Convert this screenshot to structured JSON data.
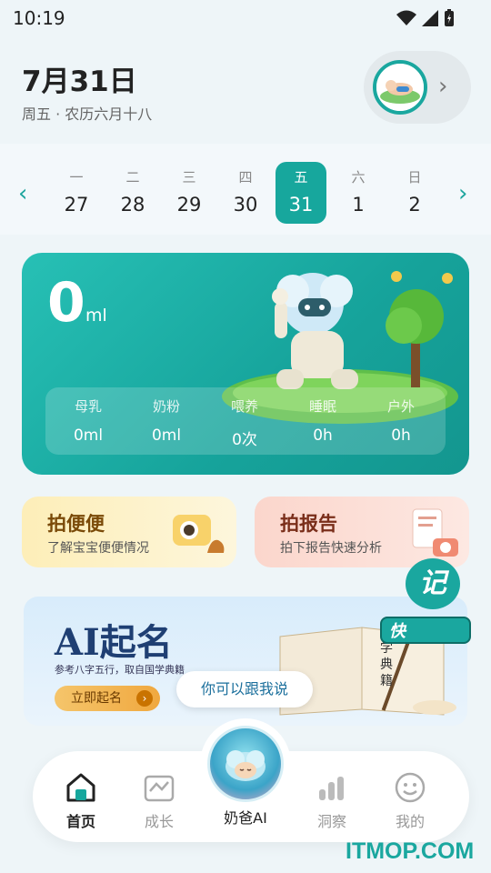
{
  "status_bar": {
    "time": "10:19"
  },
  "header": {
    "date": "7月31日",
    "lunar": "周五 · 农历六月十八"
  },
  "week": {
    "days": [
      {
        "weekday": "一",
        "date": "27"
      },
      {
        "weekday": "二",
        "date": "28"
      },
      {
        "weekday": "三",
        "date": "29"
      },
      {
        "weekday": "四",
        "date": "30"
      },
      {
        "weekday": "五",
        "date": "31"
      },
      {
        "weekday": "六",
        "date": "1"
      },
      {
        "weekday": "日",
        "date": "2"
      }
    ],
    "selected_index": 4
  },
  "summary": {
    "amount": "0",
    "unit": "ml",
    "stats": [
      {
        "label": "母乳",
        "value": "0ml"
      },
      {
        "label": "奶粉",
        "value": "0ml"
      },
      {
        "label": "喂养",
        "value": "0次"
      },
      {
        "label": "睡眠",
        "value": "0h"
      },
      {
        "label": "户外",
        "value": "0h"
      }
    ]
  },
  "quick": {
    "poo": {
      "title": "拍便便",
      "subtitle": "了解宝宝便便情况"
    },
    "report": {
      "title": "拍报告",
      "subtitle": "拍下报告快速分析"
    }
  },
  "banner": {
    "title": "AI起名",
    "subtitle": "参考八字五行，取自国学典籍",
    "button": "立即起名",
    "book_text": "国学典籍"
  },
  "chat_bubble": "你可以跟我说",
  "floating": {
    "ji": "记",
    "kuai": "快"
  },
  "tabbar": {
    "items": [
      {
        "label": "首页",
        "icon": "home-icon"
      },
      {
        "label": "成长",
        "icon": "growth-chart-icon"
      },
      {
        "label": "奶爸AI",
        "icon": "ai-assistant-icon"
      },
      {
        "label": "洞察",
        "icon": "insight-bars-icon"
      },
      {
        "label": "我的",
        "icon": "profile-face-icon"
      }
    ],
    "active_index": 0
  },
  "watermark": "ITMOP.COM",
  "colors": {
    "accent": "#17a79d",
    "banner_title": "#1f3f73"
  }
}
